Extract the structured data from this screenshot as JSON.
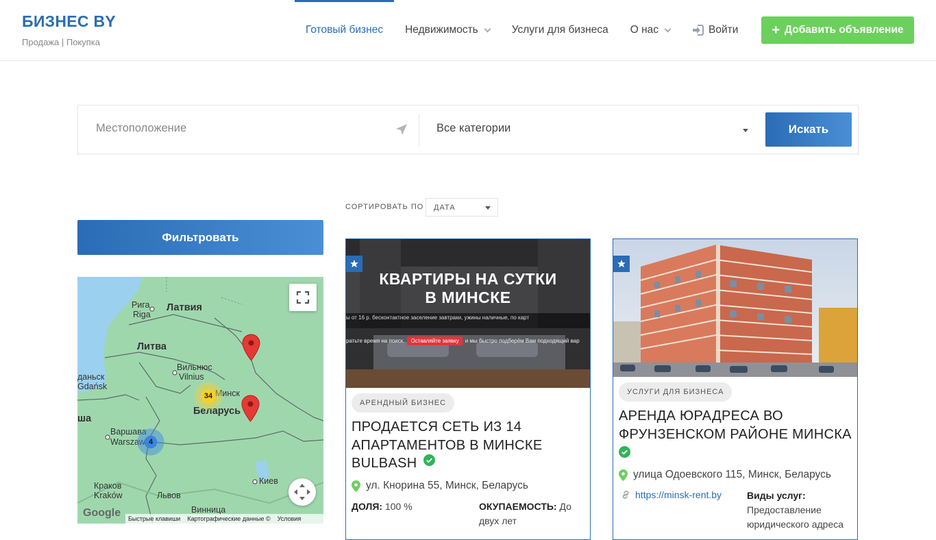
{
  "header": {
    "brand": "БИЗНЕС BY",
    "tagline": "Продажа | Покупка",
    "nav": [
      {
        "label": "Готовый бизнес"
      },
      {
        "label": "Недвижимость"
      },
      {
        "label": "Услуги для бизнеса"
      },
      {
        "label": "О нас"
      },
      {
        "label": "Войти"
      }
    ],
    "add_button": "Добавить объявление"
  },
  "search": {
    "location_placeholder": "Местоположение",
    "category_value": "Все категории",
    "button": "Искать"
  },
  "sort": {
    "label": "СОРТИРОВАТЬ ПО",
    "value": "ДАТА"
  },
  "filter_button": "Фильтровать",
  "map": {
    "labels": {
      "riga": "Рига",
      "riga2": "Riga",
      "latvia": "Латвия",
      "lithuania": "Литва",
      "vilnius": "Вильнюс",
      "vilnius2": "Vilnius",
      "gdansk": "даньск",
      "gdansk2": "Gdańsk",
      "minsk": "Минск",
      "belarus": "Беларусь",
      "warsaw": "Варшава",
      "warsaw2": "Warszawa",
      "poland": "ша",
      "krakow": "Краков",
      "krakow2": "Kraków",
      "lviv": "Львов",
      "kyiv": "Киев",
      "vinnytsia": "Винница"
    },
    "cluster_large": "34",
    "cluster_small": "4",
    "google": "Google",
    "footer": [
      "Быстрые клавиши",
      "Картографические данные ©",
      "Условия"
    ]
  },
  "listings": [
    {
      "banner_line1": "КВАРТИРЫ НА СУТКИ",
      "banner_line2": "В МИНСКЕ",
      "banner_strip": "ы от 16 р.   бесконтактное заселение   завтраки, ужины   наличные, по карт",
      "banner_cta_left": "ратьте время на поиск.",
      "banner_cta": "Оставляйте заявку",
      "banner_cta_right": "и мы быстро подберём Вам подходящий вар",
      "category": "АРЕНДНЫЙ БИЗНЕС",
      "title": "ПРОДАЕТСЯ СЕТЬ ИЗ 14 АПАРТАМЕНТОВ В МИНСКЕ BULBASH",
      "address": "ул. Кнорина 55, Минск, Беларусь",
      "share_label": "ДОЛЯ:",
      "share_value": "100 %",
      "payback_label": "ОКУПАЕМОСТЬ:",
      "payback_value": "До двух лет"
    },
    {
      "category": "УСЛУГИ ДЛЯ БИЗНЕСА",
      "title": "АРЕНДА ЮРАДРЕСА ВО ФРУНЗЕНСКОМ РАЙОНЕ МИНСКА",
      "address": "улица Одоевского 115, Минск, Беларусь",
      "link": "https://minsk-rent.by",
      "services_label": "Виды услуг:",
      "services_value": "Предоставление юридического адреса"
    }
  ],
  "colors": {
    "primary": "#2a6cb5",
    "accent_green": "#6cd05d",
    "verified": "#2fb457"
  }
}
